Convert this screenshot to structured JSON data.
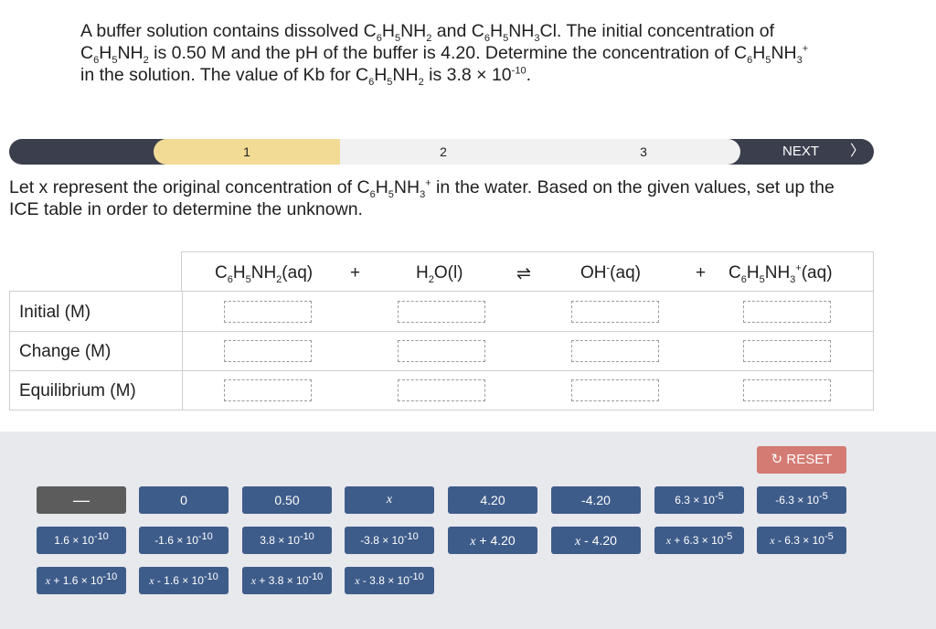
{
  "question": {
    "p1": "A buffer solution contains dissolved C",
    "p2": "H",
    "p3": "NH",
    "p4": " and C",
    "p5": "H",
    "p6": "NH",
    "p7": "Cl. The initial concentration of C",
    "p8": "H",
    "p9": "NH",
    "p10": " is 0.50 M and the pH of the buffer is 4.20. Determine the concentration of C",
    "p11": "H",
    "p12": "NH",
    "p13": " in the solution. The value of Kb for C",
    "p14": "H",
    "p15": "NH",
    "p16": " is 3.8 × 10",
    "exp": "-10",
    "end": ".",
    "sub6": "6",
    "sub5": "5",
    "sub2": "2",
    "sub3": "3",
    "plus": "+"
  },
  "progress": {
    "step1": "1",
    "step2": "2",
    "step3": "3",
    "next": "NEXT",
    "chevron": "〉"
  },
  "instruction": {
    "p1": "Let x represent the original concentration of C",
    "p2": "H",
    "p3": "NH",
    "p4": " in the water. Based on the given values, set up the ICE table in order to determine the unknown.",
    "sub6": "6",
    "sub5": "5",
    "sub3": "3",
    "plus": "+"
  },
  "ice": {
    "col1": {
      "a": "C",
      "s1": "6",
      "b": "H",
      "s2": "5",
      "c": "NH",
      "s3": "2",
      "d": "(aq)"
    },
    "plus1": "+",
    "col2": {
      "a": "H",
      "s1": "2",
      "b": "O(l)"
    },
    "arrow": "⇌",
    "col3": {
      "a": "OH",
      "sup": "-",
      "b": "(aq)"
    },
    "plus2": "+",
    "col4": {
      "a": "C",
      "s1": "6",
      "b": "H",
      "s2": "5",
      "c": "NH",
      "s3": "3",
      "sup": "+",
      "d": "(aq)"
    },
    "rows": [
      "Initial (M)",
      "Change (M)",
      "Equilibrium (M)"
    ]
  },
  "reset": {
    "icon": "↻",
    "label": "RESET"
  },
  "buttons": {
    "dash": "—",
    "zero": "0",
    "b050": "0.50",
    "x": "x",
    "b420": "4.20",
    "bm420": "-4.20",
    "b63": "6.3 × 10",
    "bm63": "-6.3 × 10",
    "e5": "-5",
    "e10": "-10",
    "b16": "1.6 × 10",
    "bm16": "-1.6 × 10",
    "b38": "3.8 × 10",
    "bm38": "-3.8 × 10",
    "xp420": " + 4.20",
    "xm420": " - 4.20",
    "xp63": " + 6.3 × 10",
    "xm63": " - 6.3 × 10",
    "xp16": " + 1.6 × 10",
    "xm16": " - 1.6 × 10",
    "xp38": " + 3.8 × 10",
    "xm38": " - 3.8 × 10"
  }
}
